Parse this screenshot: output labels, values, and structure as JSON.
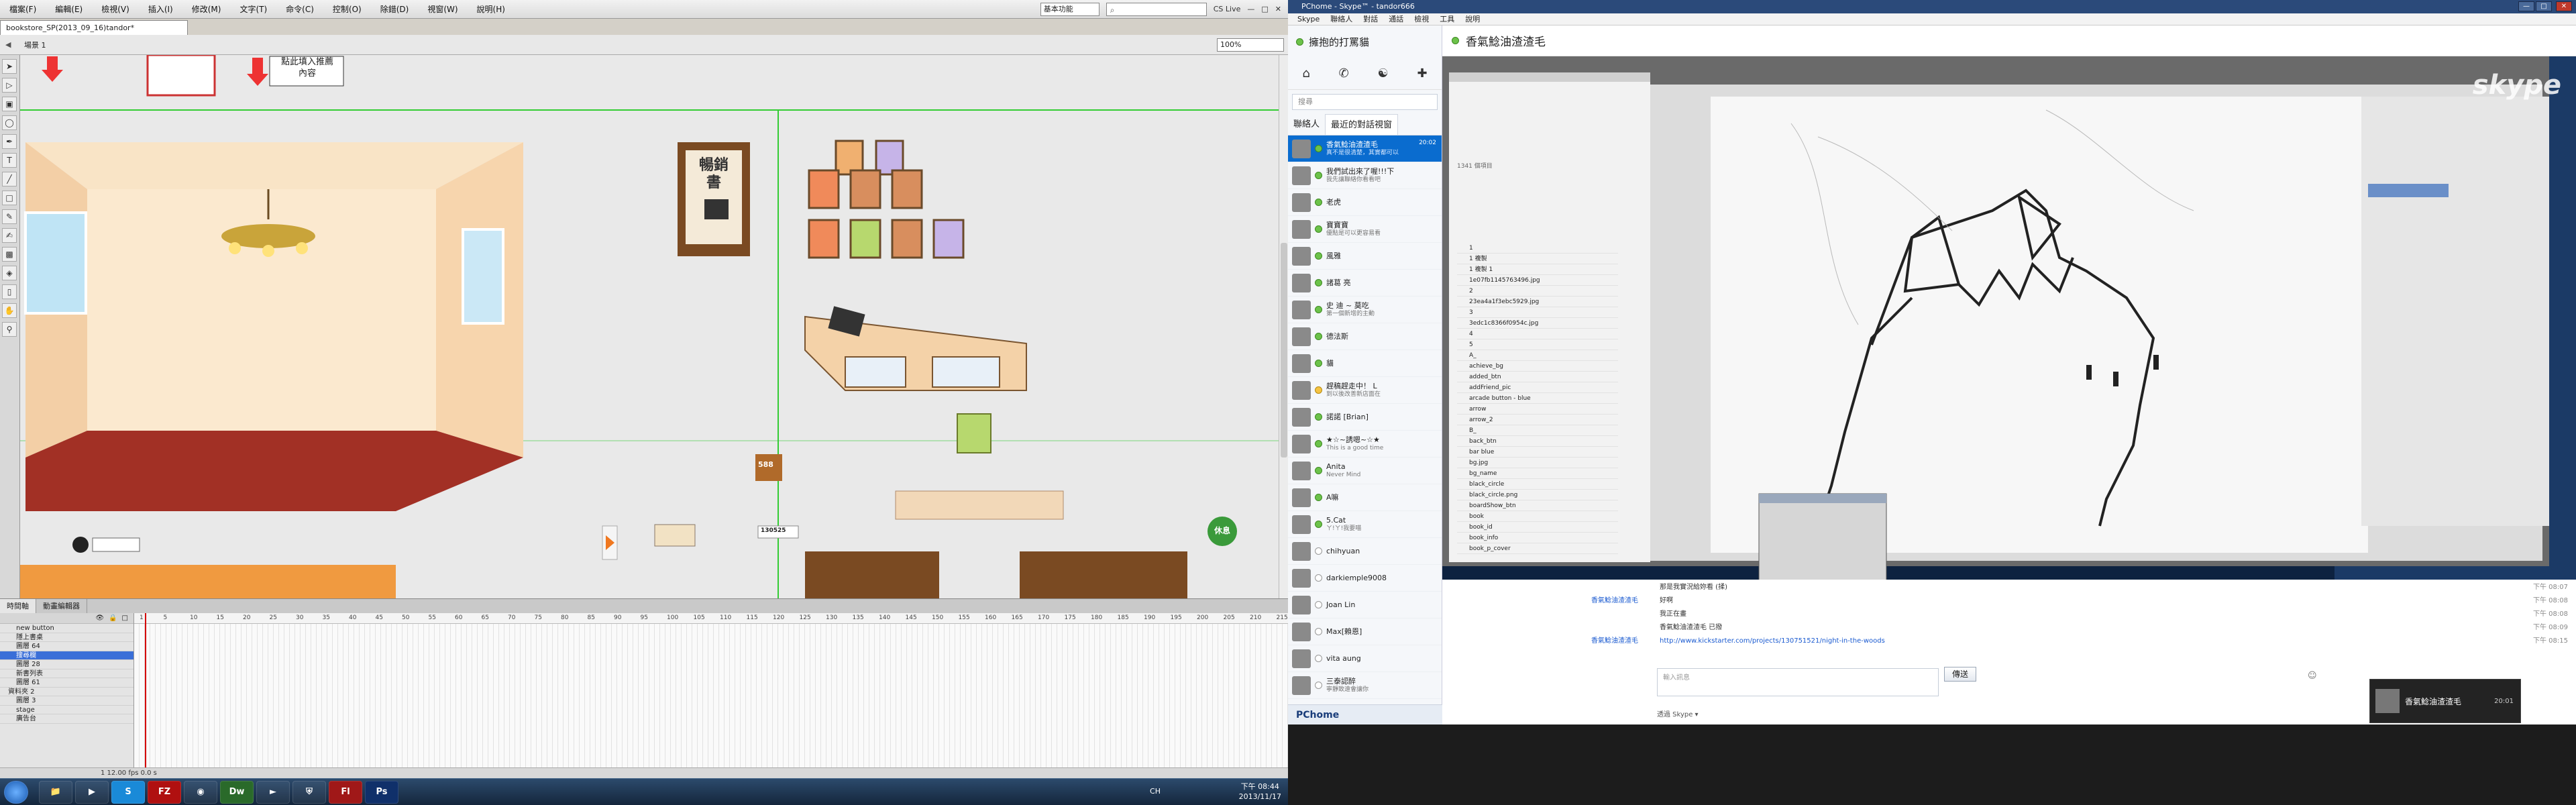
{
  "flash": {
    "menu": [
      "檔案(F)",
      "編輯(E)",
      "檢視(V)",
      "插入(I)",
      "修改(M)",
      "文字(T)",
      "命令(C)",
      "控制(O)",
      "除錯(D)",
      "視窗(W)",
      "說明(H)"
    ],
    "workspace": "基本功能",
    "cs_live": "CS Live",
    "doc_tab": "bookstore_SP(2013_09_16)tandor*",
    "scene": "場景 1",
    "zoom": "100%",
    "stage": {
      "banner_text": "點此填入推薦\n內容",
      "sign_text": "暢銷書",
      "counter_value": "130525",
      "next_button": "休息",
      "score_label": "588"
    },
    "timeline_tabs": [
      "時間軸",
      "動畫編輯器"
    ],
    "layers": [
      {
        "name": "new button",
        "selected": false,
        "folder": false
      },
      {
        "name": "隱上書桌",
        "selected": false,
        "folder": false
      },
      {
        "name": "圖層 64",
        "selected": false,
        "folder": false
      },
      {
        "name": "搜尋欄",
        "selected": true,
        "folder": false
      },
      {
        "name": "圖層 28",
        "selected": false,
        "folder": false
      },
      {
        "name": "新書列表",
        "selected": false,
        "folder": false
      },
      {
        "name": "圖層 61",
        "selected": false,
        "folder": false
      },
      {
        "name": "資料夾 2",
        "selected": false,
        "folder": true
      },
      {
        "name": "圖層 3",
        "selected": false,
        "folder": false
      },
      {
        "name": "stage",
        "selected": false,
        "folder": false
      },
      {
        "name": "廣告台",
        "selected": false,
        "folder": false
      }
    ],
    "ruler": [
      1,
      5,
      10,
      15,
      20,
      25,
      30,
      35,
      40,
      45,
      50,
      55,
      60,
      65,
      70,
      75,
      80,
      85,
      90,
      95,
      100,
      105,
      110,
      115,
      120,
      125,
      130,
      135,
      140,
      145,
      150,
      155,
      160,
      165,
      170,
      175,
      180,
      185,
      190,
      195,
      200,
      205,
      210,
      215
    ],
    "status": "1    12.00 fps    0.0 s"
  },
  "skype": {
    "window_title": "PChome - Skype™ - tandor666",
    "menu": [
      "Skype",
      "聯絡人",
      "對話",
      "通話",
      "檢視",
      "工具",
      "說明"
    ],
    "user_title": "擁抱的打罵貓",
    "search_placeholder": "搜尋",
    "tabs": [
      "聯絡人",
      "最近的對話視窗"
    ],
    "contacts": [
      {
        "name": "香氣鯰油渣渣毛",
        "msg": "真不是很清楚，其實都可以",
        "time": "20:02",
        "status": "on",
        "sel": true
      },
      {
        "name": "我們試出來了喔!!!下",
        "msg": "我先讓聯絡你看看吧",
        "time": "",
        "status": "on",
        "sel": false
      },
      {
        "name": "老虎",
        "msg": "",
        "time": "",
        "status": "on",
        "sel": false
      },
      {
        "name": "寶寶寶",
        "msg": "優點是可以更容易看",
        "time": "",
        "status": "on",
        "sel": false
      },
      {
        "name": "風雅",
        "msg": "",
        "time": "",
        "status": "on",
        "sel": false
      },
      {
        "name": "諸葛 亮",
        "msg": "",
        "time": "",
        "status": "on",
        "sel": false
      },
      {
        "name": "史 迪 ~ 莫吃",
        "msg": "第一個新增的主動",
        "time": "",
        "status": "on",
        "sel": false
      },
      {
        "name": "德法斯",
        "msg": "",
        "time": "",
        "status": "on",
        "sel": false
      },
      {
        "name": "貓",
        "msg": "",
        "time": "",
        "status": "on",
        "sel": false
      },
      {
        "name": "趕稿趕走中！ L",
        "msg": "到以後改善新店面在",
        "time": "",
        "status": "away",
        "sel": false
      },
      {
        "name": "諾諾 [Brian]",
        "msg": "",
        "time": "",
        "status": "on",
        "sel": false
      },
      {
        "name": "★☆~誘嗯~☆★",
        "msg": "This is a good time",
        "time": "",
        "status": "on",
        "sel": false
      },
      {
        "name": "Anita",
        "msg": "Never Mind",
        "time": "",
        "status": "on",
        "sel": false
      },
      {
        "name": "A嘛",
        "msg": "",
        "time": "",
        "status": "on",
        "sel": false
      },
      {
        "name": "5.Cat",
        "msg": "ㄚ!ㄚ!我要喵",
        "time": "",
        "status": "on",
        "sel": false
      },
      {
        "name": "chihyuan",
        "msg": "",
        "time": "",
        "status": "off",
        "sel": false
      },
      {
        "name": "darkiemple9008",
        "msg": "",
        "time": "",
        "status": "off",
        "sel": false
      },
      {
        "name": "Joan Lin",
        "msg": "",
        "time": "",
        "status": "off",
        "sel": false
      },
      {
        "name": "Max[賴恩]",
        "msg": "",
        "time": "",
        "status": "off",
        "sel": false
      },
      {
        "name": "vita aung",
        "msg": "",
        "time": "",
        "status": "off",
        "sel": false
      },
      {
        "name": "三泰認醉",
        "msg": "寧靜致遠會讓你",
        "time": "",
        "status": "off",
        "sel": false
      }
    ],
    "brand": "PChome",
    "chat_title": "香氣鯰油渣渣毛",
    "shared_app_list": [
      "1",
      "1 複製",
      "1 複製 1",
      "1e07fb1145763496.jpg",
      "2",
      "23ea4a1f3ebc5929.jpg",
      "3",
      "3edc1c8366f0954c.jpg",
      "4",
      "5",
      "A_",
      "achieve_bg",
      "added_btn",
      "addFriend_pic",
      "arcade button - blue",
      "arrow",
      "arrow_2",
      "B_",
      "back_btn",
      "bar blue",
      "bg.jpg",
      "bg_name",
      "black_circle",
      "black_circle.png",
      "boardShow_btn",
      "book",
      "book_id",
      "book_info",
      "book_p_cover"
    ],
    "shared_library_count": "1341 個項目",
    "messages": [
      {
        "who": "",
        "text": "那是我實況給妳看 (揉)",
        "time": "下午 08:07"
      },
      {
        "who": "香氣鯰油渣渣毛",
        "text": "好啊",
        "time": "下午 08:08"
      },
      {
        "who": "",
        "text": "我正在畫",
        "time": "下午 08:08"
      },
      {
        "who": "",
        "text": "香氣鯰油渣渣毛 已撥",
        "time": "下午 08:09"
      },
      {
        "who": "香氣鯰油渣渣毛",
        "text": "http://www.kickstarter.com/projects/130751521/night-in-the-woods",
        "time": "下午 08:15"
      }
    ],
    "input_placeholder": "輸入訊息",
    "send_label": "傳送",
    "via": "透過 Skype ▾",
    "toast_name": "香氣鯰油渣渣毛",
    "toast_time": "20:01"
  },
  "taskbar": {
    "apps": [
      "Start",
      "Explorer",
      "Media",
      "Skype",
      "FileZilla",
      "Chrome",
      "Dreamweaver",
      "Media Player",
      "Shield",
      "Flash",
      "Photoshop"
    ],
    "lang": "CH",
    "time": "下午 08:44",
    "date": "2013/11/17"
  }
}
